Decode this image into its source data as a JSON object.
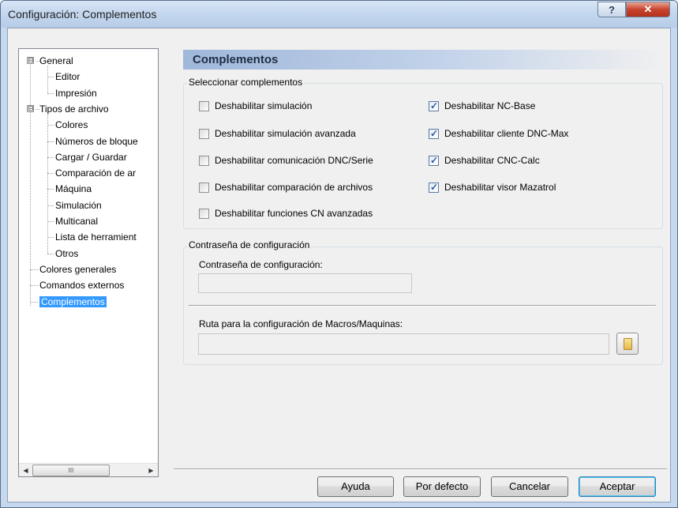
{
  "window": {
    "title": "Configuración: Complementos",
    "help_glyph": "?",
    "close_glyph": "✕"
  },
  "tree": {
    "items": [
      {
        "label": "General",
        "level": 0,
        "expander": "⊟"
      },
      {
        "label": "Editor",
        "level": 1
      },
      {
        "label": "Impresión",
        "level": 1
      },
      {
        "label": "Tipos de archivo",
        "level": 0,
        "expander": "⊟"
      },
      {
        "label": "Colores",
        "level": 1
      },
      {
        "label": "Números de bloque",
        "level": 1
      },
      {
        "label": "Cargar / Guardar",
        "level": 1
      },
      {
        "label": "Comparación de ar",
        "level": 1
      },
      {
        "label": "Máquina",
        "level": 1
      },
      {
        "label": "Simulación",
        "level": 1
      },
      {
        "label": "Multicanal",
        "level": 1
      },
      {
        "label": "Lista de herramient",
        "level": 1
      },
      {
        "label": "Otros",
        "level": 1
      },
      {
        "label": "Colores generales",
        "level": 0
      },
      {
        "label": "Comandos externos",
        "level": 0
      },
      {
        "label": "Complementos",
        "level": 0,
        "selected": true
      }
    ],
    "scroll": {
      "left_arrow": "◀",
      "right_arrow": "▶",
      "thumb_grip": "III"
    }
  },
  "panel": {
    "title": "Complementos",
    "plugins_group": {
      "label": "Seleccionar complementos",
      "left": [
        {
          "label": "Deshabilitar simulación",
          "checked": false
        },
        {
          "label": "Deshabilitar simulación avanzada",
          "checked": false
        },
        {
          "label": "Deshabilitar comunicación DNC/Serie",
          "checked": false
        },
        {
          "label": "Deshabilitar comparación de archivos",
          "checked": false
        },
        {
          "label": "Deshabilitar funciones CN avanzadas",
          "checked": false
        }
      ],
      "right": [
        {
          "label": "Deshabilitar NC-Base",
          "checked": true
        },
        {
          "label": "Deshabilitar cliente DNC-Max",
          "checked": true
        },
        {
          "label": "Deshabilitar CNC-Calc",
          "checked": true
        },
        {
          "label": "Deshabilitar visor Mazatrol",
          "checked": true
        }
      ]
    },
    "password_group": {
      "label": "Contraseña de configuración",
      "field_label": "Contraseña de configuración:",
      "field_value": "",
      "path_label": "Ruta para la configuración de Macros/Maquinas:",
      "path_value": ""
    }
  },
  "buttons": {
    "help": "Ayuda",
    "defaults": "Por defecto",
    "cancel": "Cancelar",
    "accept": "Aceptar"
  }
}
